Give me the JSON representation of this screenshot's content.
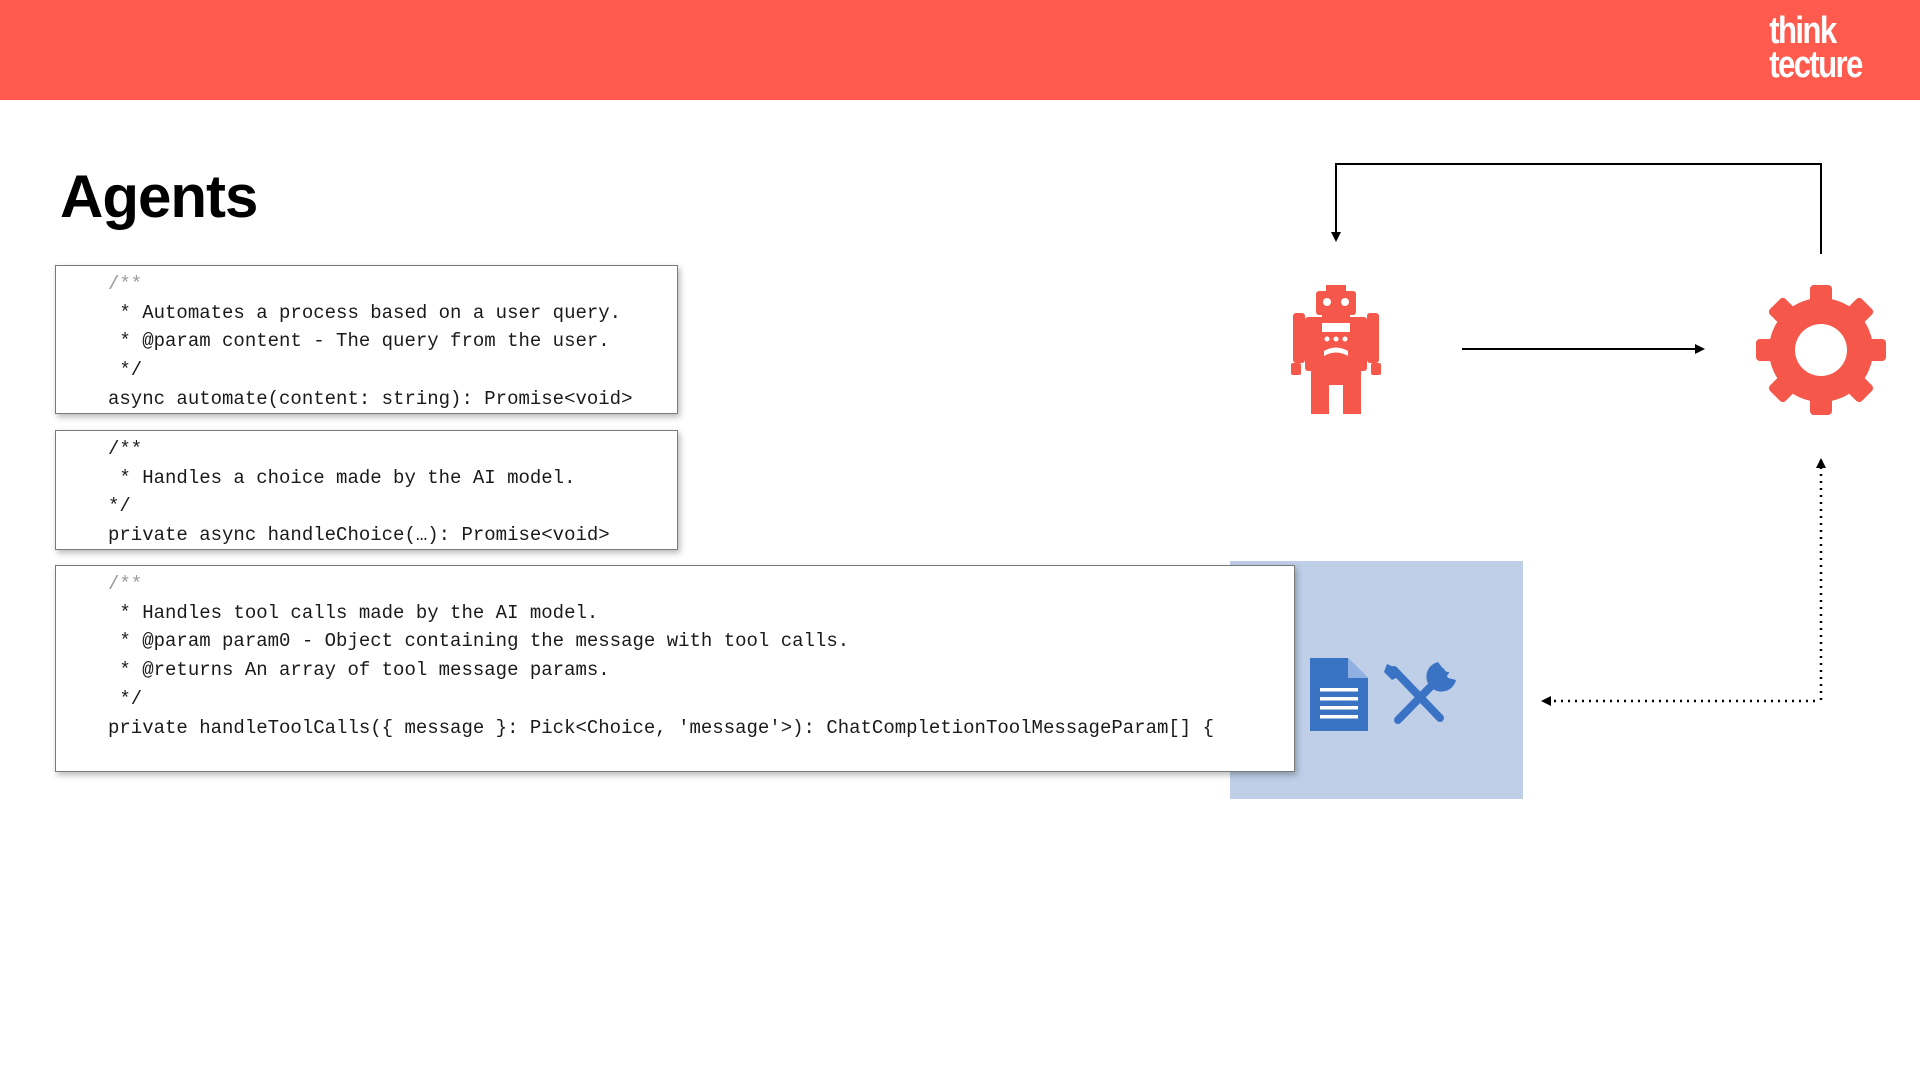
{
  "header": {
    "brand_color": "#fe5a4e",
    "logo_line1": "think",
    "logo_line2": "tecture"
  },
  "slide": {
    "title": "Agents"
  },
  "code_blocks": [
    {
      "lines": [
        "/**",
        " * Automates a process based on a user query.",
        " * @param content - The query from the user.",
        " */",
        "async automate(content: string): Promise<void>"
      ]
    },
    {
      "lines": [
        "/**",
        " * Handles a choice made by the AI model.",
        "*/",
        "private async handleChoice(…): Promise<void>"
      ]
    },
    {
      "lines": [
        "/**",
        " * Handles tool calls made by the AI model.",
        " * @param param0 - Object containing the message with tool calls.",
        " * @returns An array of tool message params.",
        " */",
        "private handleToolCalls({ message }: Pick<Choice, 'message'>): ChatCompletionToolMessageParam[] {"
      ]
    }
  ],
  "diagram": {
    "icons": [
      "robot-icon",
      "gear-icon",
      "document-icon",
      "tools-icon"
    ],
    "accent_color": "#f5574b",
    "tool_color": "#3a73c4",
    "panel_color": "#bfcfe8"
  }
}
